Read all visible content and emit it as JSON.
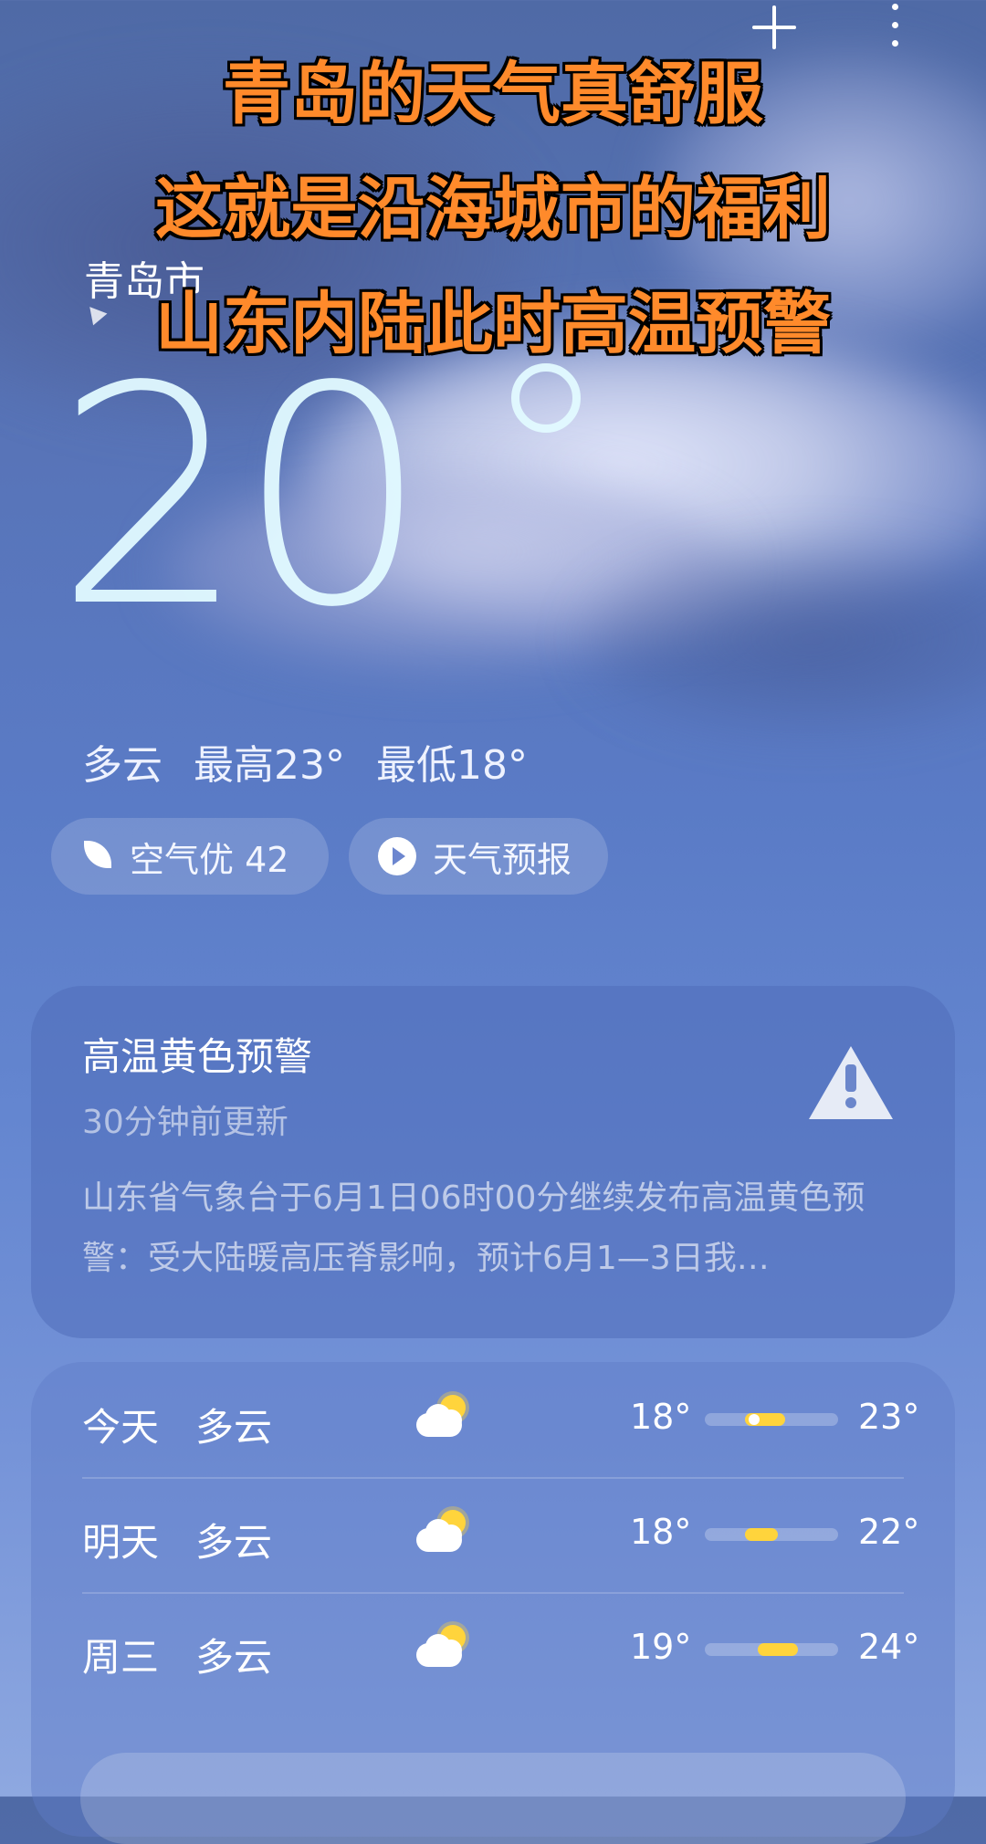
{
  "overlay": {
    "line1": "青岛的天气真舒服",
    "line2": "这就是沿海城市的福利",
    "line3": "山东内陆此时高温预警"
  },
  "location": {
    "city": "青岛市"
  },
  "current": {
    "temperature": "20",
    "condition": "多云",
    "high": "最高23°",
    "low": "最低18°"
  },
  "chips": {
    "air_quality": "空气优 42",
    "forecast_video": "天气预报"
  },
  "alert": {
    "title": "高温黄色预警",
    "updated": "30分钟前更新",
    "body": "山东省气象台于6月1日06时00分继续发布高温黄色预警：受大陆暖高压脊影响，预计6月1—3日我…"
  },
  "forecast": [
    {
      "day": "今天",
      "condition": "多云",
      "icon": "partly-cloudy-icon",
      "low": "18°",
      "high": "23°",
      "bar_start": 0.3,
      "bar_end": 0.6,
      "now": 0.33
    },
    {
      "day": "明天",
      "condition": "多云",
      "icon": "partly-cloudy-icon",
      "low": "18°",
      "high": "22°",
      "bar_start": 0.3,
      "bar_end": 0.55,
      "now": null
    },
    {
      "day": "周三",
      "condition": "多云",
      "icon": "partly-cloudy-icon",
      "low": "19°",
      "high": "24°",
      "bar_start": 0.4,
      "bar_end": 0.7,
      "now": null
    }
  ],
  "colors": {
    "accent_bar": "#ffd43c",
    "overlay_text": "#ff8a2b"
  }
}
